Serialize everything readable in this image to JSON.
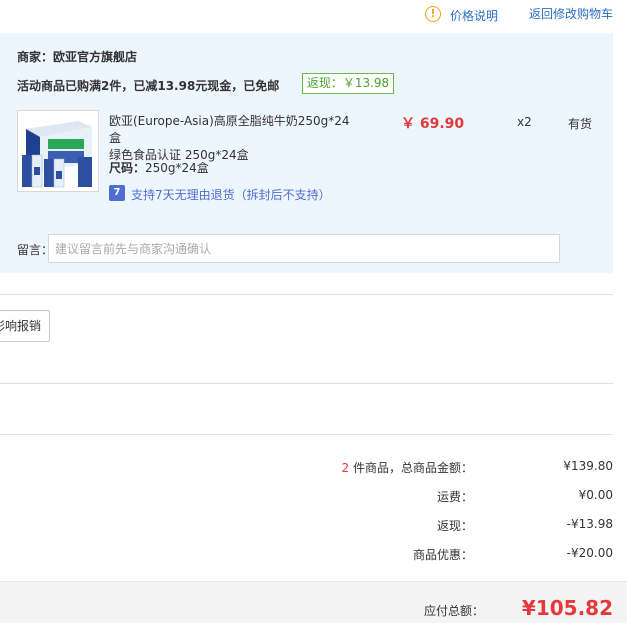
{
  "header": {
    "price_info_label": "价格说明",
    "back_to_cart_label": "返回修改购物车"
  },
  "store": {
    "merchant_label": "商家：欧亚官方旗舰店",
    "promo_text": "活动商品已购满2件，已减13.98元现金，已免邮",
    "rebate_badge": "返现：￥13.98",
    "product": {
      "name_line1": "欧亚(Europe-Asia)高原全脂纯牛奶250g*24盒",
      "name_line2": "绿色食品认证 250g*24盒",
      "price": "￥ 69.90",
      "quantity": "x2",
      "stock_status": "有货",
      "size_label": "尺码：",
      "size_value": "250g*24盒",
      "return_icon_text": "7",
      "return_policy": "支持7天无理由退货（拆封后不支持）"
    },
    "remark": {
      "label": "留言：",
      "placeholder": "建议留言前先与商家沟通确认"
    }
  },
  "invoice_button_label": "影响报销",
  "summary": {
    "item_count": "2",
    "total_amount_label": " 件商品，总商品金额：",
    "total_amount_value": "¥139.80",
    "shipping_label": "运费：",
    "shipping_value": "¥0.00",
    "rebate_label": "返现：",
    "rebate_value": "-¥13.98",
    "discount_label": "商品优惠：",
    "discount_value": "-¥20.00",
    "payable_label": "应付总额：",
    "payable_value": "¥105.82"
  },
  "colors": {
    "accent_red": "#e4393c",
    "link_blue": "#2b6fc2",
    "store_bg": "#eef6fd",
    "rebate_green": "#4aa22f"
  }
}
